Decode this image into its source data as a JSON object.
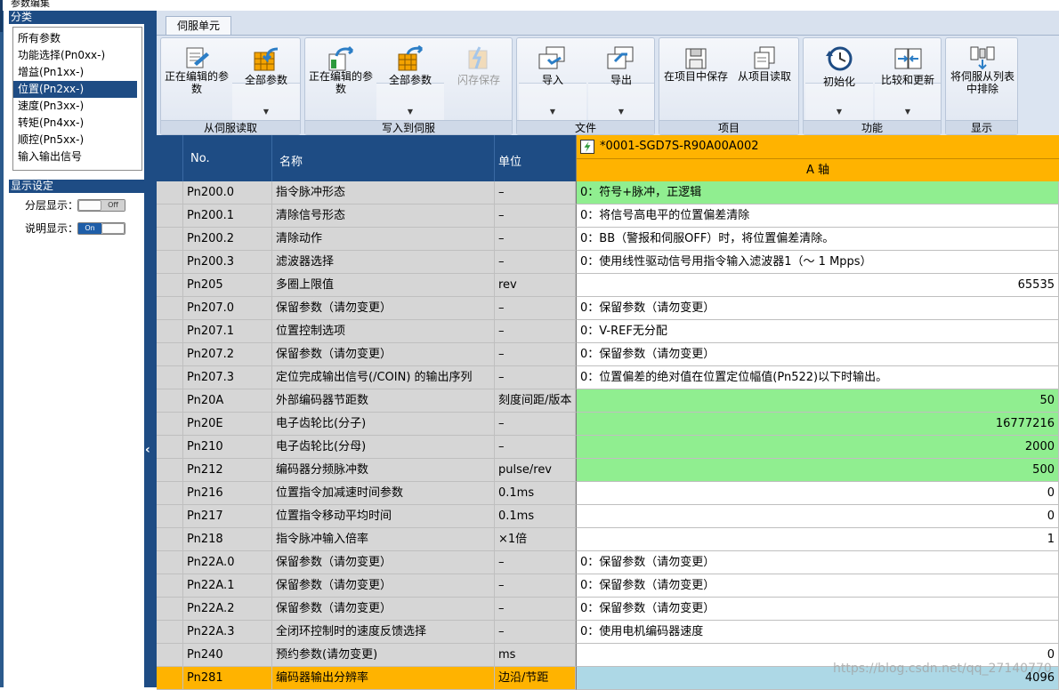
{
  "window": {
    "title": "参数编集"
  },
  "left_panel": {
    "category_header": "分类",
    "categories": [
      {
        "label": "所有参数",
        "selected": false
      },
      {
        "label": "功能选择(Pn0xx-)",
        "selected": false
      },
      {
        "label": "增益(Pn1xx-)",
        "selected": false
      },
      {
        "label": "位置(Pn2xx-)",
        "selected": true
      },
      {
        "label": "速度(Pn3xx-)",
        "selected": false
      },
      {
        "label": "转矩(Pn4xx-)",
        "selected": false
      },
      {
        "label": "顺控(Pn5xx-)",
        "selected": false
      },
      {
        "label": "输入输出信号",
        "selected": false
      }
    ],
    "display_header": "显示设定",
    "layer_display": {
      "label": "分层显示：",
      "state": "Off"
    },
    "desc_display": {
      "label": "说明显示：",
      "state": "On"
    }
  },
  "ribbon": {
    "tab": "伺服单元",
    "groups": [
      {
        "label": "从伺服读取",
        "buttons": [
          "正在编辑的参数",
          "全部参数"
        ]
      },
      {
        "label": "写入到伺服",
        "buttons": [
          "正在编辑的参数",
          "全部参数",
          "闪存保存"
        ]
      },
      {
        "label": "文件",
        "buttons": [
          "导入",
          "导出"
        ]
      },
      {
        "label": "项目",
        "buttons": [
          "在项目中保存",
          "从项目读取"
        ]
      },
      {
        "label": "功能",
        "buttons": [
          "初始化",
          "比较和更新"
        ]
      },
      {
        "label": "显示",
        "buttons": [
          "将伺服从列表中排除"
        ]
      }
    ]
  },
  "grid": {
    "columns": {
      "no": "No.",
      "name": "名称",
      "unit": "单位"
    },
    "device": "*0001-SGD7S-R90A00A002",
    "axis": "A 轴",
    "rows": [
      {
        "no": "Pn200.0",
        "name": "指令脉冲形态",
        "unit": "–",
        "value": "0：符号+脉冲，正逻辑",
        "num": false,
        "style": "green"
      },
      {
        "no": "Pn200.1",
        "name": "清除信号形态",
        "unit": "–",
        "value": "0：将信号高电平的位置偏差清除",
        "num": false,
        "style": ""
      },
      {
        "no": "Pn200.2",
        "name": "清除动作",
        "unit": "–",
        "value": "0：BB（警报和伺服OFF）时，将位置偏差清除。",
        "num": false,
        "style": ""
      },
      {
        "no": "Pn200.3",
        "name": "滤波器选择",
        "unit": "–",
        "value": "0：使用线性驱动信号用指令输入滤波器1（～ 1 Mpps）",
        "num": false,
        "style": ""
      },
      {
        "no": "Pn205",
        "name": "多圈上限值",
        "unit": "rev",
        "value": "65535",
        "num": true,
        "style": ""
      },
      {
        "no": "Pn207.0",
        "name": "保留参数（请勿变更）",
        "unit": "–",
        "value": "0：保留参数（请勿变更）",
        "num": false,
        "style": ""
      },
      {
        "no": "Pn207.1",
        "name": "位置控制选项",
        "unit": "–",
        "value": "0：V-REF无分配",
        "num": false,
        "style": ""
      },
      {
        "no": "Pn207.2",
        "name": "保留参数（请勿变更）",
        "unit": "–",
        "value": "0：保留参数（请勿变更）",
        "num": false,
        "style": ""
      },
      {
        "no": "Pn207.3",
        "name": "定位完成输出信号(/COIN) 的输出序列",
        "unit": "–",
        "value": "0：位置偏差的绝对值在位置定位幅值(Pn522)以下时输出。",
        "num": false,
        "style": ""
      },
      {
        "no": "Pn20A",
        "name": "外部编码器节距数",
        "unit": "刻度间距/版本",
        "value": "50",
        "num": true,
        "style": "green"
      },
      {
        "no": "Pn20E",
        "name": "电子齿轮比(分子)",
        "unit": "–",
        "value": "16777216",
        "num": true,
        "style": "green"
      },
      {
        "no": "Pn210",
        "name": "电子齿轮比(分母)",
        "unit": "–",
        "value": "2000",
        "num": true,
        "style": "green"
      },
      {
        "no": "Pn212",
        "name": "编码器分频脉冲数",
        "unit": "pulse/rev",
        "value": "500",
        "num": true,
        "style": "green"
      },
      {
        "no": "Pn216",
        "name": "位置指令加减速时间参数",
        "unit": "0.1ms",
        "value": "0",
        "num": true,
        "style": ""
      },
      {
        "no": "Pn217",
        "name": "位置指令移动平均时间",
        "unit": "0.1ms",
        "value": "0",
        "num": true,
        "style": ""
      },
      {
        "no": "Pn218",
        "name": "指令脉冲输入倍率",
        "unit": "×1倍",
        "value": "1",
        "num": true,
        "style": ""
      },
      {
        "no": "Pn22A.0",
        "name": "保留参数（请勿变更）",
        "unit": "–",
        "value": "0：保留参数（请勿变更）",
        "num": false,
        "style": ""
      },
      {
        "no": "Pn22A.1",
        "name": "保留参数（请勿变更）",
        "unit": "–",
        "value": "0：保留参数（请勿变更）",
        "num": false,
        "style": ""
      },
      {
        "no": "Pn22A.2",
        "name": "保留参数（请勿变更）",
        "unit": "–",
        "value": "0：保留参数（请勿变更）",
        "num": false,
        "style": ""
      },
      {
        "no": "Pn22A.3",
        "name": "全闭环控制时的速度反馈选择",
        "unit": "–",
        "value": "0：使用电机编码器速度",
        "num": false,
        "style": ""
      },
      {
        "no": "Pn240",
        "name": "预约参数(请勿变更)",
        "unit": "ms",
        "value": "0",
        "num": true,
        "style": ""
      },
      {
        "no": "Pn281",
        "name": "编码器输出分辨率",
        "unit": "边沿/节距",
        "value": "4096",
        "num": true,
        "style": "hl"
      }
    ]
  },
  "watermark": "https://blog.csdn.net/qq_27140770",
  "colors": {
    "header_blue": "#1e4c84",
    "orange": "#ffb300",
    "green": "#90ee90",
    "selected_blue": "#add8e6"
  }
}
